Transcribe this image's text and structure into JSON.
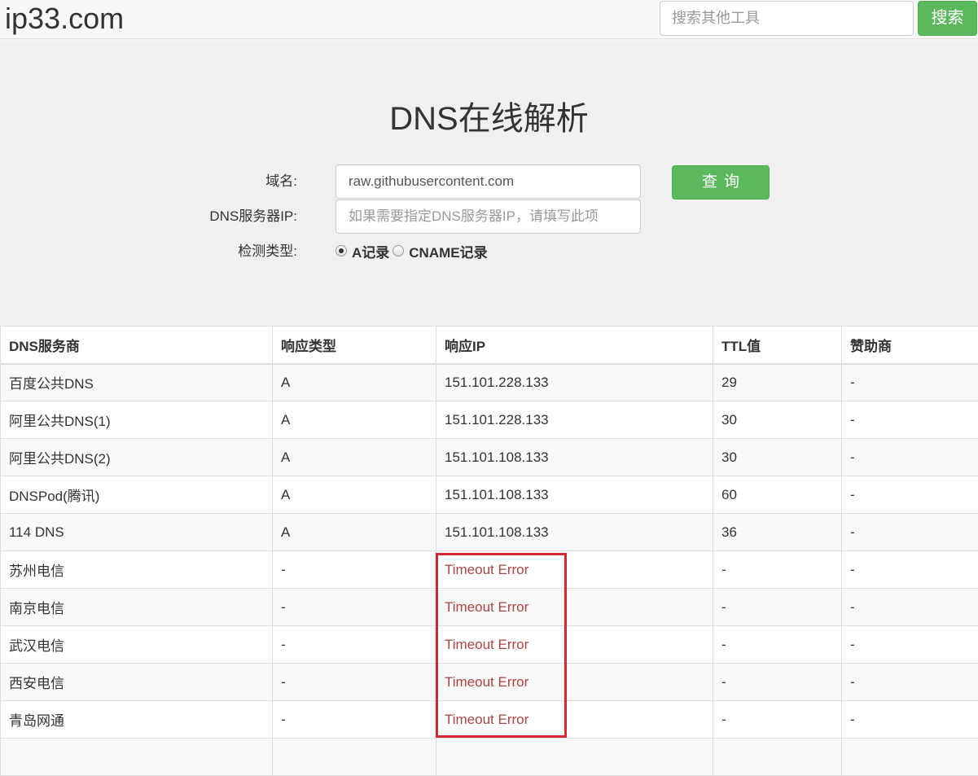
{
  "header": {
    "logo": "ip33.com",
    "search_placeholder": "搜索其他工具",
    "search_button": "搜索"
  },
  "main": {
    "title": "DNS在线解析",
    "domain_label": "域名:",
    "domain_value": "raw.githubusercontent.com",
    "dns_server_label": "DNS服务器IP:",
    "dns_server_placeholder": "如果需要指定DNS服务器IP，请填写此项",
    "query_button": "查询",
    "type_label": "检测类型:",
    "type_options": [
      {
        "label": "A记录",
        "checked": true
      },
      {
        "label": "CNAME记录",
        "checked": false
      }
    ]
  },
  "table": {
    "headers": [
      "DNS服务商",
      "响应类型",
      "响应IP",
      "TTL值",
      "赞助商"
    ],
    "rows": [
      [
        "百度公共DNS",
        "A",
        "151.101.228.133",
        "29",
        "-"
      ],
      [
        "阿里公共DNS(1)",
        "A",
        "151.101.228.133",
        "30",
        "-"
      ],
      [
        "阿里公共DNS(2)",
        "A",
        "151.101.108.133",
        "30",
        "-"
      ],
      [
        "DNSPod(腾讯)",
        "A",
        "151.101.108.133",
        "60",
        "-"
      ],
      [
        "114 DNS",
        "A",
        "151.101.108.133",
        "36",
        "-"
      ],
      [
        "苏州电信",
        "-",
        "Timeout Error",
        "-",
        "-"
      ],
      [
        "南京电信",
        "-",
        "Timeout Error",
        "-",
        "-"
      ],
      [
        "武汉电信",
        "-",
        "Timeout Error",
        "-",
        "-"
      ],
      [
        "西安电信",
        "-",
        "Timeout Error",
        "-",
        "-"
      ],
      [
        "青岛网通",
        "-",
        "Timeout Error",
        "-",
        "-"
      ],
      [
        "",
        "",
        "",
        "",
        ""
      ]
    ]
  },
  "colors": {
    "accent_green": "#5cb85c",
    "error_text": "#a94442",
    "highlight_box": "#d9262c"
  }
}
